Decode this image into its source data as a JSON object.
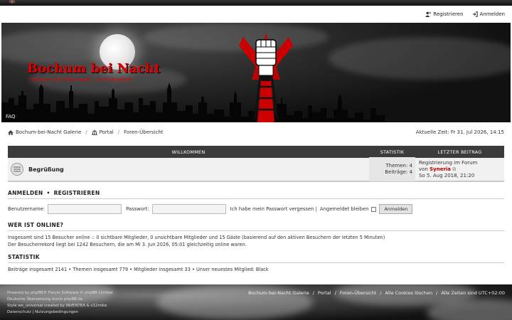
{
  "topnav": {
    "register": "Registrieren",
    "login": "Anmelden"
  },
  "header": {
    "title": "Bochum bei Nacht",
    "description": "\"Vampire dim Mauerpark – im Ruhrgebiet\"",
    "faq": "FAQ"
  },
  "breadcrumbs": {
    "items": [
      "Bochum-bei-Nacht Galerie",
      "Portal",
      "Foren-Übersicht"
    ],
    "current_time": "Aktuelle Zeit: Fr 31. Jul 2026, 14:15"
  },
  "forum": {
    "headers": {
      "category": "WILLKOMMEN",
      "stats": "STATISTIK",
      "last_post": "LETZTER BEITRAG"
    },
    "rows": [
      {
        "title": "Begrüßung",
        "topics": "Themen: 4",
        "posts": "Beiträge: 4",
        "last_post_title": "Registrierung im Forum",
        "last_post_by": "von",
        "last_post_author": "Syneria",
        "last_post_date": "So 5. Aug 2018, 21:20"
      }
    ]
  },
  "login_section": {
    "heading_login": "ANMELDEN",
    "heading_register": "REGISTRIEREN",
    "username_label": "Benutzername:",
    "password_label": "Passwort:",
    "forgot": "Ich habe mein Passwort vergessen |",
    "remember": "Angemeldet bleiben",
    "submit": "Anmelden"
  },
  "online": {
    "heading": "WER IST ONLINE?",
    "line1": "Insgesamt sind 15 Besucher online :: 0 sichtbare Mitglieder, 0 unsichtbare Mitglieder und 15 Gäste (basierend auf den aktiven Besuchern der letzten 5 Minuten)",
    "line2": "Der Besucherrekord liegt bei 1242 Besuchern, die am Mi 3. Jun 2026, 05:01 gleichzeitig online waren."
  },
  "stats": {
    "heading": "STATISTIK",
    "line": "Beiträge insgesamt 2141 • Themen insgesamt 779 • Mitglieder insgesamt 33 • Unser neuestes Mitglied: Black"
  },
  "footer": {
    "line1": "Powered by phpBB® Forum Software © phpBB Limited",
    "line2": "Deutsche Übersetzung durch phpBB.de",
    "line3": "Style we_universal created by INVENTEA & v12mike",
    "line4": "Datenschutz | Nutzungsbedingungen",
    "links": [
      "Bochum-bei-Nacht Galerie",
      "/",
      "Portal",
      "/",
      "Foren-Übersicht",
      "/",
      "Alle Cookies löschen",
      "/",
      "Alle Zeiten sind UTC+02:00"
    ]
  },
  "colors": {
    "accent": "#dd0000",
    "header_bar": "#3b3b3b"
  }
}
